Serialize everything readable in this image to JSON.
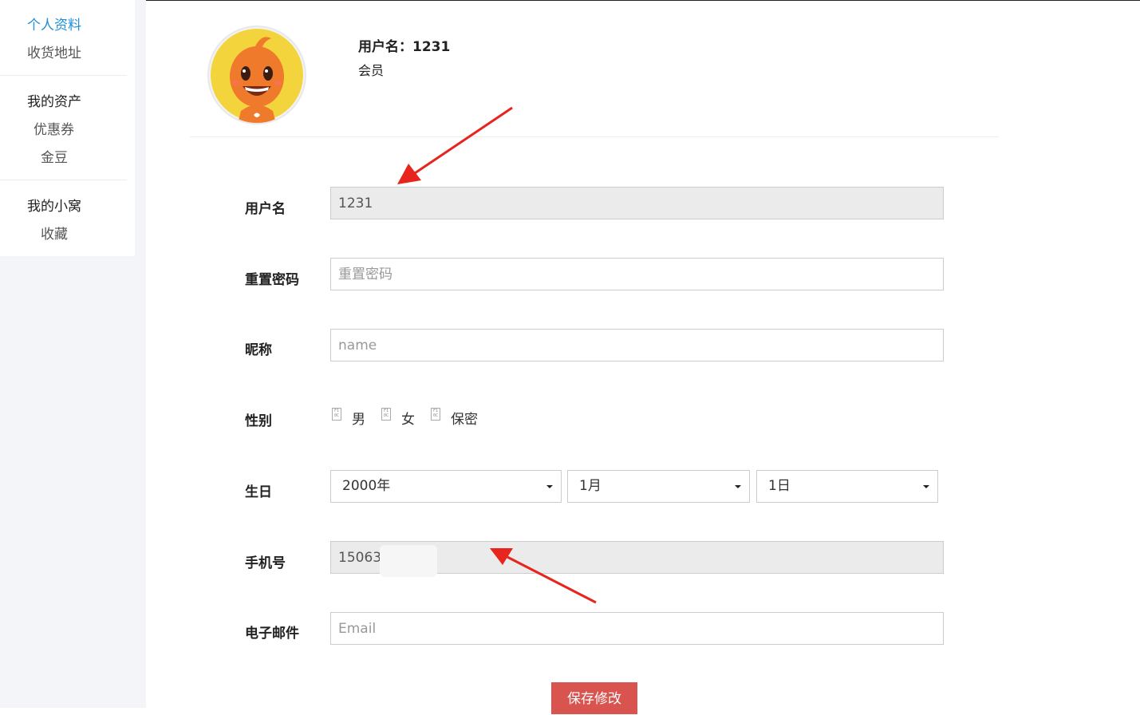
{
  "sidebar": {
    "links": [
      {
        "label": "个人资料",
        "active": true
      },
      {
        "label": "收货地址",
        "active": false
      }
    ],
    "groups": [
      {
        "title": "我的资产",
        "items": [
          "优惠券",
          "金豆"
        ]
      },
      {
        "title": "我的小窝",
        "items": [
          "收藏"
        ]
      }
    ]
  },
  "header": {
    "username_label": "用户名：",
    "username_value": "1231",
    "role": "会员",
    "avatar_icon": "mascot-avatar-icon"
  },
  "form": {
    "username": {
      "label": "用户名",
      "value": "1231"
    },
    "password": {
      "label": "重置密码",
      "placeholder": "重置密码"
    },
    "nickname": {
      "label": "昵称",
      "placeholder": "name"
    },
    "gender": {
      "label": "性别",
      "options": [
        "男",
        "女",
        "保密"
      ]
    },
    "birthday": {
      "label": "生日",
      "year": "2000年",
      "month": "1月",
      "day": "1日"
    },
    "phone": {
      "label": "手机号",
      "value": "15063"
    },
    "email": {
      "label": "电子邮件",
      "placeholder": "Email"
    },
    "save_label": "保存修改"
  },
  "colors": {
    "link_active": "#1e90d5",
    "save_button": "#d9534f",
    "annotation_arrow": "#e8251c"
  }
}
